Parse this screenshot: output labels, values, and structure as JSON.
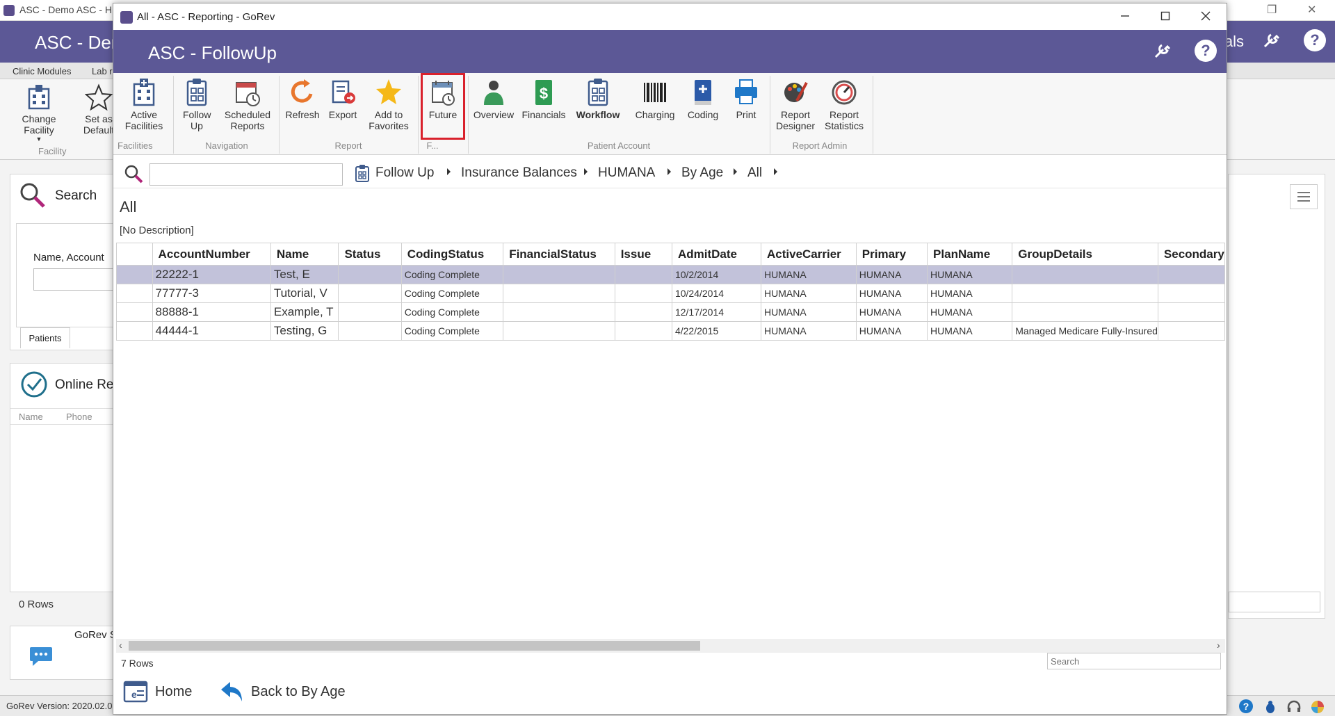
{
  "background_app": {
    "title": "ASC - Demo ASC - H",
    "header_title": "ASC - Der",
    "header_right": "ials",
    "tabs": [
      "Clinic Modules",
      "Lab r"
    ],
    "ribbon": {
      "change_facility": "Change Facility",
      "set_as_default": "Set as Default",
      "group": "Facility"
    },
    "search_label": "Search",
    "name_account_label": "Name, Account",
    "patients_tab": "Patients",
    "online_label": "Online Re",
    "cols": [
      "Name",
      "Phone"
    ],
    "rows_label": "0 Rows",
    "gorev_label": "GoRev S",
    "version": "GoRev Version: 2020.02.0"
  },
  "window": {
    "title": "All - ASC - Reporting - GoRev",
    "header_title": "ASC - FollowUp"
  },
  "ribbon": {
    "groups": {
      "facilities": "Facilities",
      "navigation": "Navigation",
      "report": "Report",
      "future": "F...",
      "patient_account": "Patient Account",
      "report_admin": "Report Admin"
    },
    "buttons": {
      "active_facilities": "Active Facilities",
      "follow_up": "Follow Up",
      "scheduled_reports": "Scheduled Reports",
      "refresh": "Refresh",
      "export": "Export",
      "add_to_favorites": "Add to Favorites",
      "future": "Future",
      "overview": "Overview",
      "financials": "Financials",
      "workflow": "Workflow",
      "charging": "Charging",
      "coding": "Coding",
      "print": "Print",
      "report_designer": "Report Designer",
      "report_statistics": "Report Statistics"
    }
  },
  "breadcrumb": {
    "search_value": "",
    "items": [
      "Follow Up",
      "Insurance Balances",
      "HUMANA",
      "By Age",
      "All"
    ]
  },
  "page": {
    "heading": "All",
    "description": "[No Description]"
  },
  "grid": {
    "columns": [
      "AccountNumber",
      "Name",
      "Status",
      "CodingStatus",
      "FinancialStatus",
      "Issue",
      "AdmitDate",
      "ActiveCarrier",
      "Primary",
      "PlanName",
      "GroupDetails",
      "Secondary"
    ],
    "rows": [
      [
        "22222-1",
        "Test, E",
        "",
        "Coding Complete",
        "",
        "",
        "10/2/2014",
        "HUMANA",
        "HUMANA",
        "HUMANA",
        "",
        ""
      ],
      [
        "77777-3",
        "Tutorial, V",
        "",
        "Coding Complete",
        "",
        "",
        "10/24/2014",
        "HUMANA",
        "HUMANA",
        "HUMANA",
        "",
        ""
      ],
      [
        "88888-1",
        "Example, T",
        "",
        "Coding Complete",
        "",
        "",
        "12/17/2014",
        "HUMANA",
        "HUMANA",
        "HUMANA",
        "",
        ""
      ],
      [
        "44444-1",
        "Testing, G",
        "",
        "Coding Complete",
        "",
        "",
        "4/22/2015",
        "HUMANA",
        "HUMANA",
        "HUMANA",
        "Managed Medicare Fully-Insured",
        ""
      ]
    ],
    "row_count": "7 Rows",
    "search_placeholder": "Search"
  },
  "footer": {
    "home": "Home",
    "back": "Back to By Age"
  },
  "colors": {
    "header": "#5c5896",
    "selected_row": "#c2c2da",
    "highlight": "#d9212c"
  }
}
